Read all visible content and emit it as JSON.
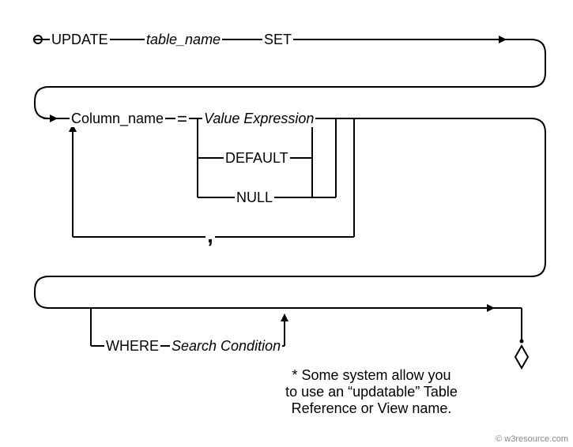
{
  "row1": {
    "update": "UPDATE",
    "table_name": "table_name",
    "set": "SET"
  },
  "row2": {
    "column_name": "Column_name",
    "equals": "=",
    "value_expression": "Value Expression",
    "default": "DEFAULT",
    "null": "NULL",
    "comma": ","
  },
  "row3": {
    "where": "WHERE",
    "search_condition": "Search Condition"
  },
  "footnote": {
    "line1": "* Some system allow you",
    "line2": "to use an “updatable” Table",
    "line3": "Reference or View name."
  },
  "watermark": "© w3resource.com"
}
